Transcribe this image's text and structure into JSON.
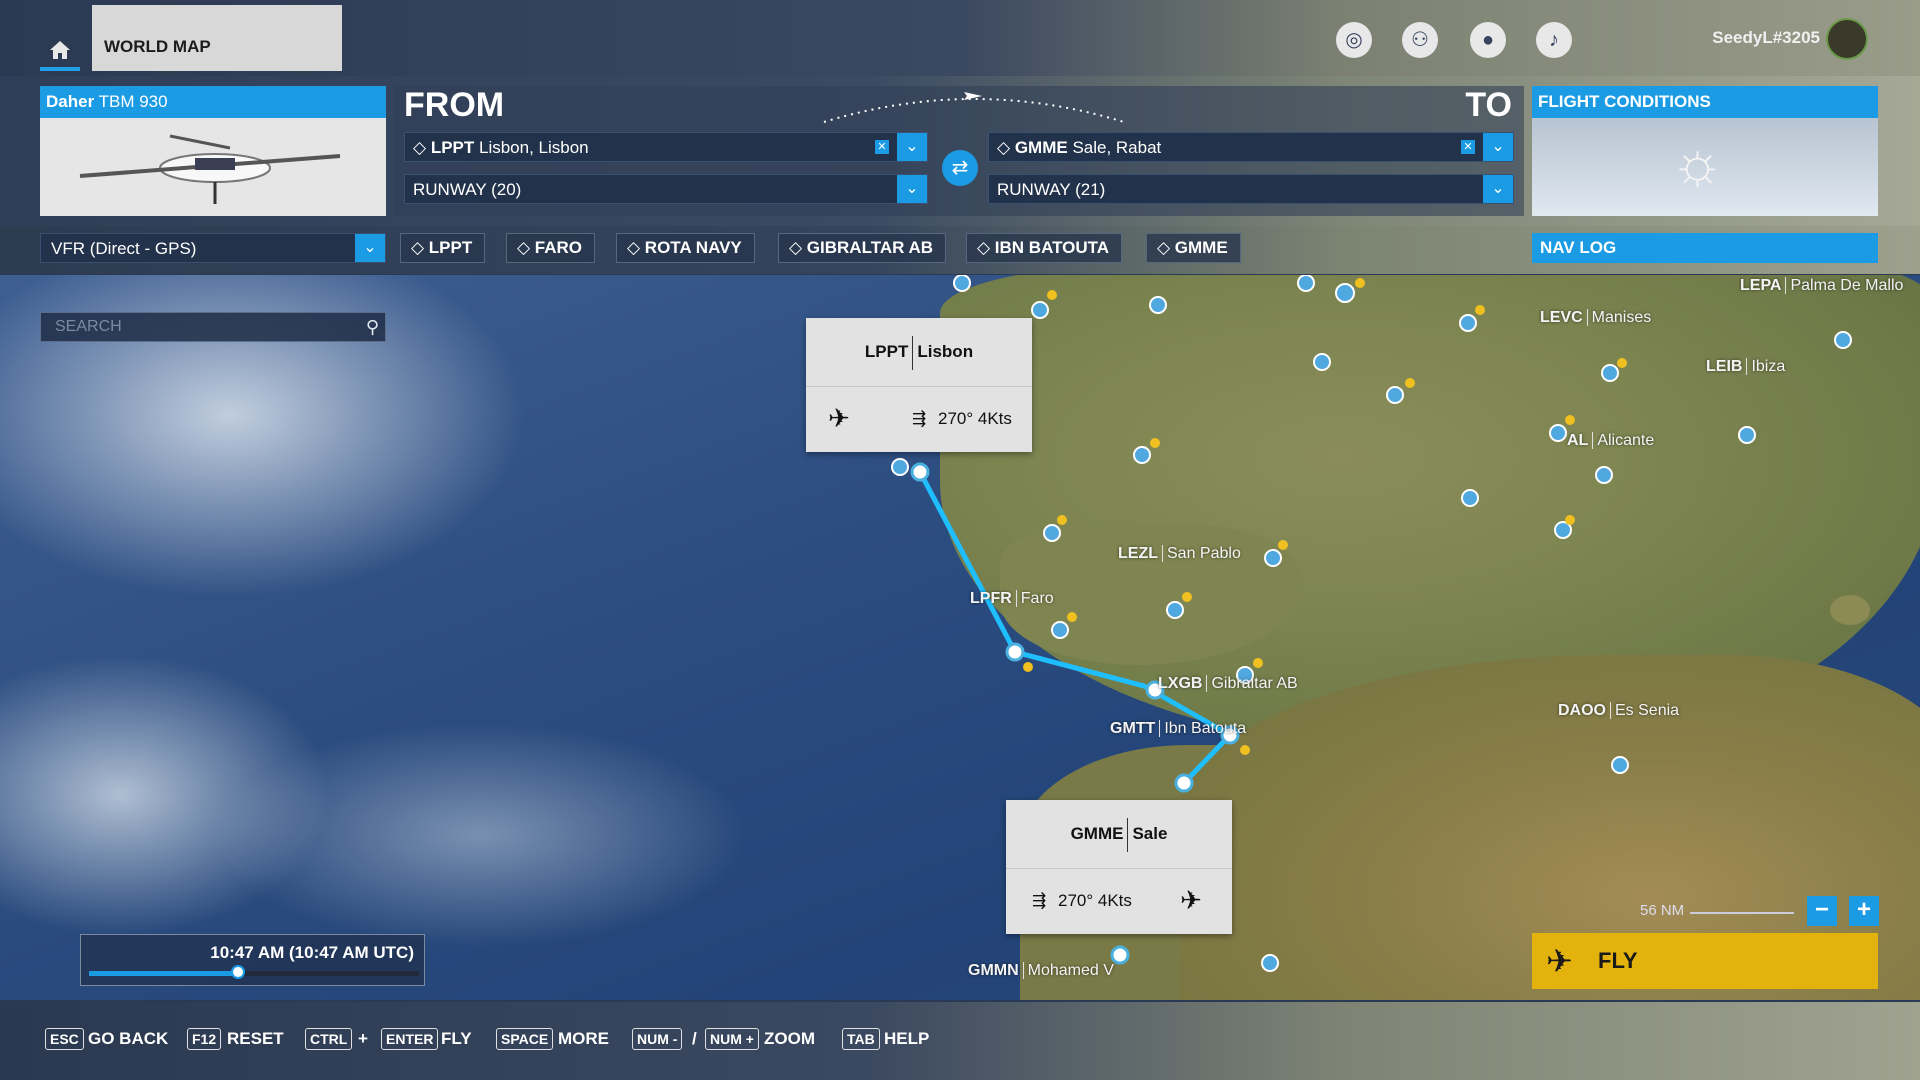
{
  "topbar": {
    "world_map_tab": "WORLD MAP",
    "username": "SeedyL#3205",
    "icons": [
      "home-icon",
      "activity-icon",
      "friends-icon",
      "profile-icon",
      "notifications-icon"
    ]
  },
  "aircraft": {
    "make": "Daher",
    "model": "TBM 930"
  },
  "from": {
    "title": "FROM",
    "icao": "LPPT",
    "name": "Lisbon, Lisbon",
    "runway": "RUNWAY (20)"
  },
  "to": {
    "title": "TO",
    "icao": "GMME",
    "name": "Sale, Rabat",
    "runway": "RUNWAY (21)"
  },
  "flight_conditions": {
    "label": "FLIGHT CONDITIONS",
    "weather": "partly-cloudy-icon"
  },
  "route": {
    "type": "VFR (Direct - GPS)",
    "waypoints": [
      "LPPT",
      "FARO",
      "ROTA NAVY",
      "GIBRALTAR AB",
      "IBN BATOUTA",
      "GMME"
    ]
  },
  "nav_log": "NAV LOG",
  "search": {
    "placeholder": "SEARCH"
  },
  "popups": {
    "departure": {
      "icao": "LPPT",
      "name": "Lisbon",
      "wind": "270° 4Kts"
    },
    "arrival": {
      "icao": "GMME",
      "name": "Sale",
      "wind": "270° 4Kts"
    }
  },
  "map_labels": [
    {
      "icao": "LEPA",
      "name": "Palma De Mallo"
    },
    {
      "icao": "LEVC",
      "name": "Manises"
    },
    {
      "icao": "LEIB",
      "name": "Ibiza"
    },
    {
      "icao": "AL",
      "name": "Alicante"
    },
    {
      "icao": "LEZL",
      "name": "San Pablo"
    },
    {
      "icao": "LPFR",
      "name": "Faro"
    },
    {
      "icao": "LXGB",
      "name": "Gibraltar AB"
    },
    {
      "icao": "GMTT",
      "name": "Ibn Batouta"
    },
    {
      "icao": "DAOO",
      "name": "Es Senia"
    },
    {
      "icao": "GMMN",
      "name": "Mohamed V"
    }
  ],
  "time": {
    "display": "10:47 AM (10:47 AM UTC)",
    "day_progress": 0.45
  },
  "zoom": {
    "scale": "56 NM",
    "minus": "−",
    "plus": "+"
  },
  "fly_button": "FLY",
  "shortcuts": [
    {
      "keys": [
        "ESC"
      ],
      "label": "GO BACK"
    },
    {
      "keys": [
        "F12"
      ],
      "label": "RESET"
    },
    {
      "keys": [
        "CTRL",
        "ENTER"
      ],
      "label": "FLY"
    },
    {
      "keys": [
        "SPACE"
      ],
      "label": "MORE"
    },
    {
      "keys": [
        "NUM -",
        "NUM +"
      ],
      "label": "ZOOM"
    },
    {
      "keys": [
        "TAB"
      ],
      "label": "HELP"
    }
  ],
  "colors": {
    "accent": "#1c9be5",
    "fly": "#e3b20c",
    "route": "#1fbfff"
  }
}
